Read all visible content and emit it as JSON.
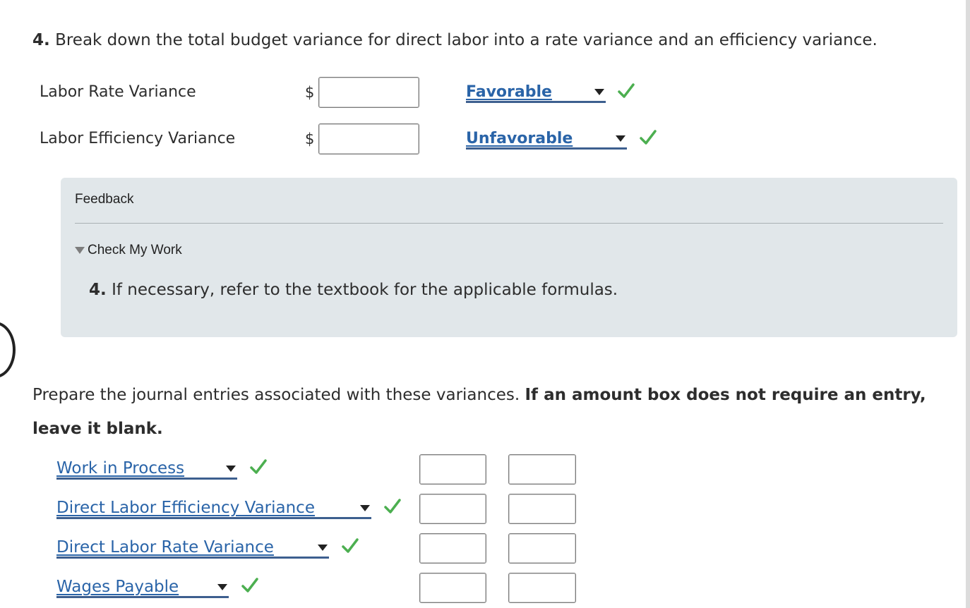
{
  "question": {
    "number": "4.",
    "text": "Break down the total budget variance for direct labor into a rate variance and an efficiency variance."
  },
  "variances": [
    {
      "label": "Labor Rate Variance",
      "currency": "$",
      "amount": "",
      "selection": "Favorable"
    },
    {
      "label": "Labor Efficiency Variance",
      "currency": "$",
      "amount": "",
      "selection": "Unfavorable"
    }
  ],
  "feedback": {
    "title": "Feedback",
    "toggle_label": "Check My Work",
    "hint_number": "4.",
    "hint_text": "If necessary, refer to the textbook for the applicable formulas."
  },
  "journal": {
    "instruction_plain": "Prepare the journal entries associated with these variances.",
    "instruction_bold": "If an amount box does not require an entry, leave it blank.",
    "entries": [
      {
        "account": "Work in Process",
        "debit": "",
        "credit": ""
      },
      {
        "account": "Direct Labor Efficiency Variance",
        "debit": "",
        "credit": ""
      },
      {
        "account": "Direct Labor Rate Variance",
        "debit": "",
        "credit": ""
      },
      {
        "account": "Wages Payable",
        "debit": "",
        "credit": ""
      }
    ]
  },
  "colors": {
    "link_blue": "#2a64a8",
    "check_green": "#4caf50",
    "feedback_bg": "#e1e7ea"
  },
  "icons": [
    "check-icon",
    "dropdown-caret-icon",
    "disclosure-triangle-icon"
  ]
}
